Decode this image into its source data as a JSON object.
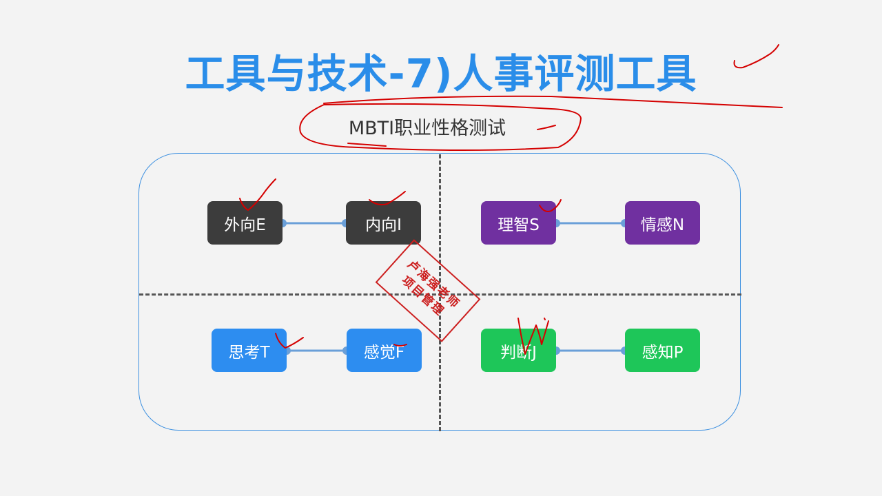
{
  "title": "工具与技术-7)人事评测工具",
  "subtitle": "MBTI职业性格测试",
  "stamp": {
    "line1": "卢海强老师",
    "line2": "项目管理"
  },
  "quadrants": {
    "top_left": {
      "left": "外向E",
      "right": "内向I",
      "color": "#3c3c3c"
    },
    "top_right": {
      "left": "理智S",
      "right": "情感N",
      "color": "#7030a0"
    },
    "bottom_left": {
      "left": "思考T",
      "right": "感觉F",
      "color": "#2d8df0"
    },
    "bottom_right": {
      "left": "判断J",
      "right": "感知P",
      "color": "#1ec659"
    }
  },
  "colors": {
    "title": "#2a8de9",
    "border": "#3b8fe0",
    "connector": "#6a9fd8",
    "annotation": "#d40000"
  }
}
